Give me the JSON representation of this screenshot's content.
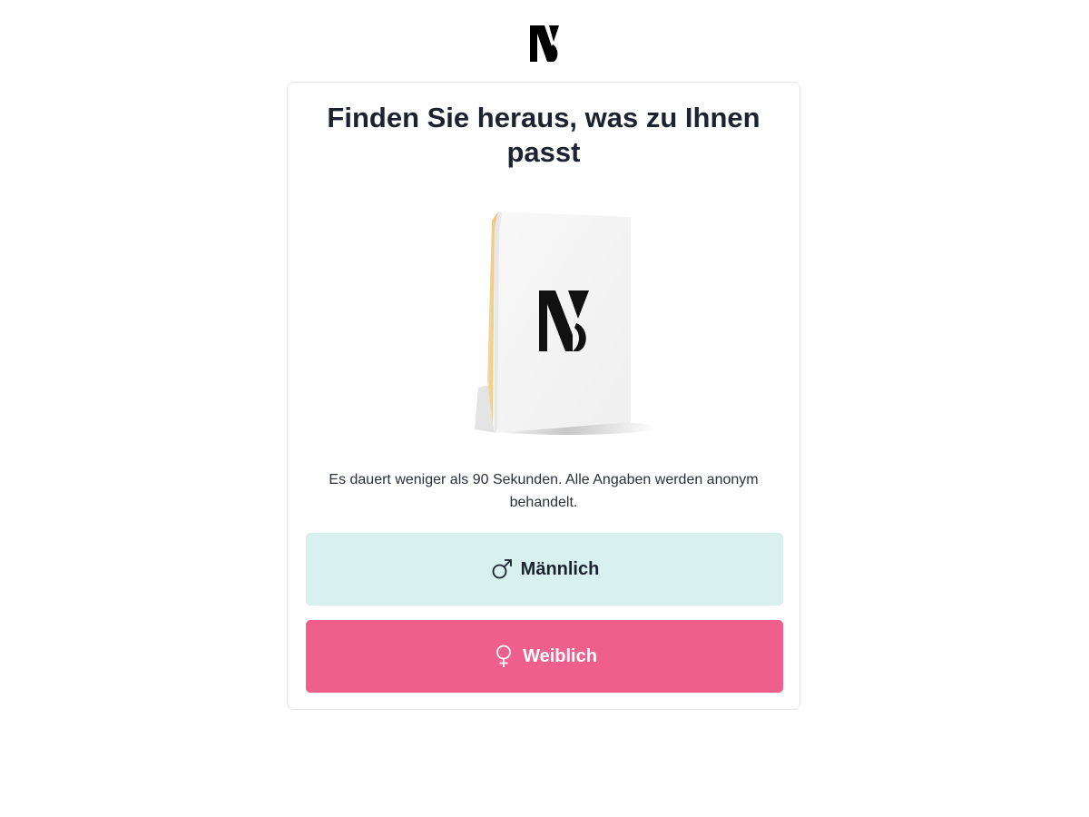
{
  "brand": {
    "logo_icon": "brand-logo-icon"
  },
  "quiz": {
    "title": "Finden Sie heraus, was zu Ihnen passt",
    "product_image_icon": "product-box-icon",
    "description": "Es dauert weniger als 90 Sekunden. Alle Angaben werden anonym behandelt.",
    "options": {
      "male": {
        "label": "Männlich",
        "icon": "male-symbol-icon",
        "background": "#d8f0ee"
      },
      "female": {
        "label": "Weiblich",
        "icon": "female-symbol-icon",
        "background": "#ef5f8c"
      }
    }
  },
  "colors": {
    "accent_pink": "#ef5f8c",
    "accent_mint": "#d8f0ee",
    "text_dark": "#1c2230"
  }
}
